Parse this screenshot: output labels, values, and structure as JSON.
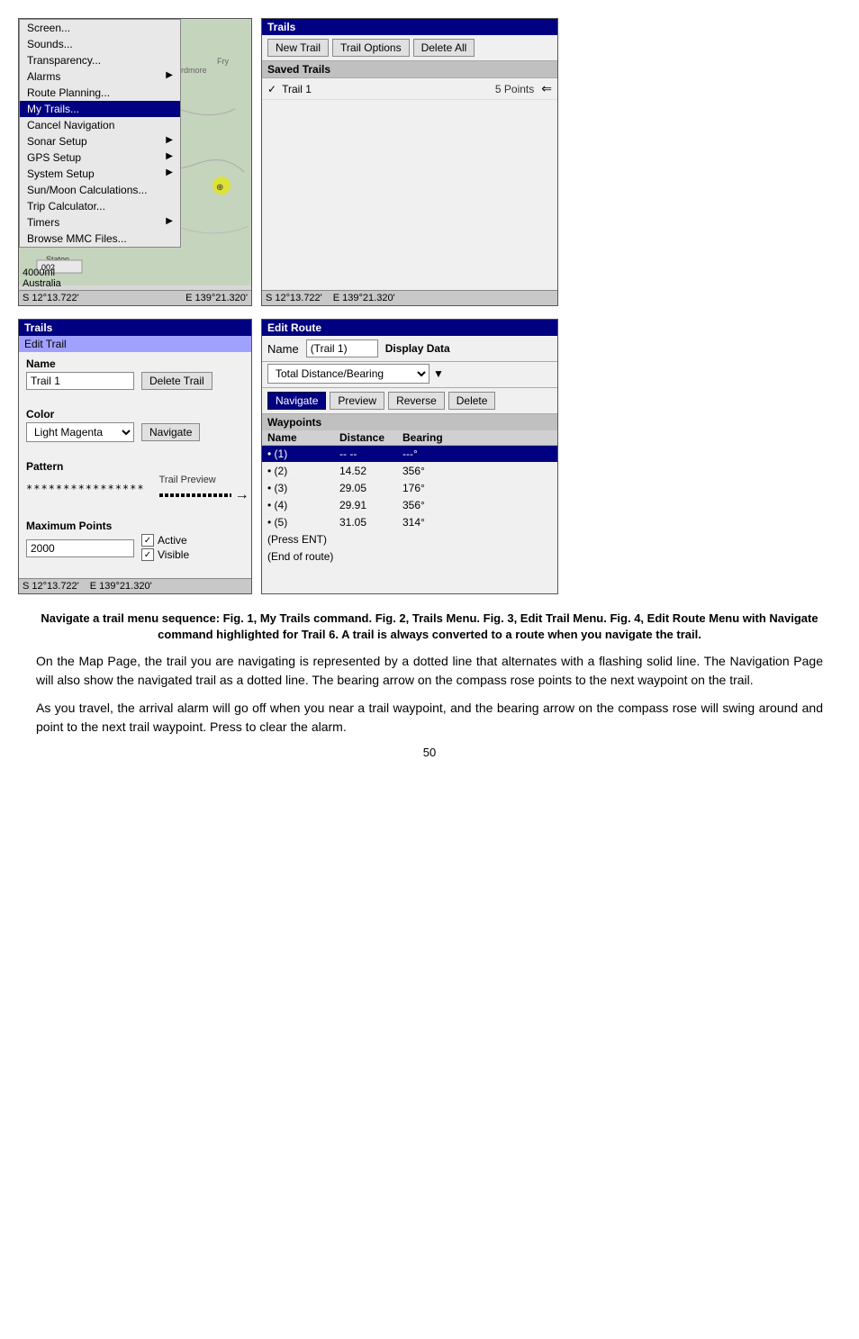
{
  "fig1": {
    "title": "Screen...",
    "menu_items": [
      {
        "label": "Screen...",
        "highlighted": false,
        "has_arrow": false
      },
      {
        "label": "Sounds...",
        "highlighted": false,
        "has_arrow": false
      },
      {
        "label": "Transparency...",
        "highlighted": false,
        "has_arrow": false
      },
      {
        "label": "Alarms",
        "highlighted": false,
        "has_arrow": true
      },
      {
        "label": "Route Planning...",
        "highlighted": false,
        "has_arrow": false
      },
      {
        "label": "My Trails...",
        "highlighted": true,
        "has_arrow": false
      },
      {
        "label": "Cancel Navigation",
        "highlighted": false,
        "has_arrow": false
      },
      {
        "label": "Sonar Setup",
        "highlighted": false,
        "has_arrow": true
      },
      {
        "label": "GPS Setup",
        "highlighted": false,
        "has_arrow": true
      },
      {
        "label": "System Setup",
        "highlighted": false,
        "has_arrow": true
      },
      {
        "label": "Sun/Moon Calculations...",
        "highlighted": false,
        "has_arrow": false
      },
      {
        "label": "Trip Calculator...",
        "highlighted": false,
        "has_arrow": false
      },
      {
        "label": "Timers",
        "highlighted": false,
        "has_arrow": true
      },
      {
        "label": "Browse MMC Files...",
        "highlighted": false,
        "has_arrow": false
      }
    ],
    "scale": "4000mi",
    "region": "Australia",
    "coords_s": "S  12°13.722'",
    "coords_e": "E  139°21.320'"
  },
  "fig2": {
    "title": "Trails",
    "buttons": {
      "new_trail": "New Trail",
      "trail_options": "Trail Options",
      "delete_all": "Delete All"
    },
    "saved_trails_label": "Saved Trails",
    "trails": [
      {
        "check": true,
        "name": "Trail 1",
        "points": "5 Points"
      }
    ],
    "coords_s": "S  12°13.722'",
    "coords_e": "E  139°21.320'"
  },
  "fig3": {
    "panel_title": "Trails",
    "subtitle": "Edit Trail",
    "name_label": "Name",
    "name_value": "Trail 1",
    "delete_btn": "Delete Trail",
    "color_label": "Color",
    "color_value": "Light Magenta",
    "navigate_btn": "Navigate",
    "pattern_label": "Pattern",
    "pattern_value": "****************",
    "trail_preview_label": "Trail Preview",
    "max_points_label": "Maximum Points",
    "max_points_value": "2000",
    "active_label": "Active",
    "visible_label": "Visible",
    "coords_s": "S  12°13.722'",
    "coords_e": "E  139°21.320'"
  },
  "fig4": {
    "panel_title": "Edit Route",
    "name_label": "Name",
    "name_value": "(Trail 1)",
    "display_label": "Display Data",
    "display_value": "Total Distance/Bearing",
    "buttons": {
      "navigate": "Navigate",
      "preview": "Preview",
      "reverse": "Reverse",
      "delete": "Delete"
    },
    "waypoints_header": "Waypoints",
    "columns": [
      "Name",
      "Distance",
      "Bearing"
    ],
    "waypoints": [
      {
        "name": "• (1)",
        "distance": "-- --",
        "bearing": "---°",
        "highlighted": true
      },
      {
        "name": "• (2)",
        "distance": "14.52",
        "bearing": "356°",
        "highlighted": false
      },
      {
        "name": "• (3)",
        "distance": "29.05",
        "bearing": "176°",
        "highlighted": false
      },
      {
        "name": "• (4)",
        "distance": "29.91",
        "bearing": "356°",
        "highlighted": false
      },
      {
        "name": "• (5)",
        "distance": "31.05",
        "bearing": "314°",
        "highlighted": false
      },
      {
        "name": "(Press ENT)",
        "distance": "",
        "bearing": "",
        "highlighted": false
      },
      {
        "name": "(End of route)",
        "distance": "",
        "bearing": "",
        "highlighted": false
      }
    ]
  },
  "caption": {
    "text": "Navigate a trail menu sequence: Fig. 1, My Trails command. Fig. 2, Trails Menu. Fig. 3, Edit Trail Menu. Fig. 4, Edit Route Menu with Navigate command highlighted for Trail 6. A trail is always converted to a route when you navigate the trail."
  },
  "body": {
    "paragraph1": "On the Map Page, the trail you are navigating is represented by a dotted line that alternates with a flashing solid line. The Navigation Page will also show the navigated trail as a dotted line. The bearing arrow on the compass rose points to the next waypoint on the trail.",
    "paragraph2": "As you travel, the arrival alarm will go off when you near a trail waypoint, and the bearing arrow on the compass rose will swing around and point to the next trail waypoint. Press      to clear the alarm."
  },
  "page_number": "50"
}
